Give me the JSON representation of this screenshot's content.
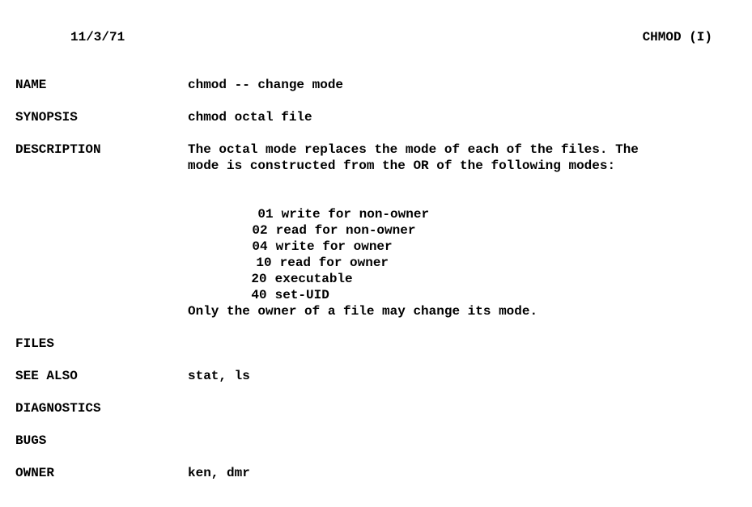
{
  "header": {
    "date": "11/3/71",
    "title": "CHMOD (I)"
  },
  "sections": {
    "name": {
      "label": "NAME",
      "text": "chmod -- change mode"
    },
    "synopsis": {
      "label": "SYNOPSIS",
      "text": "chmod octal file"
    },
    "description": {
      "label": "DESCRIPTION",
      "line1": "The octal mode replaces the mode of each of the files. The",
      "line2": "mode is constructed from the OR of the following modes:",
      "modes": [
        {
          "code": "01",
          "desc": "write for non-owner"
        },
        {
          "code": "02",
          "desc": "read for non-owner"
        },
        {
          "code": "04",
          "desc": "write for owner"
        },
        {
          "code": "10",
          "desc": "read for owner"
        },
        {
          "code": "20",
          "desc": "executable"
        },
        {
          "code": "40",
          "desc": "set-UID"
        }
      ],
      "closing": "Only the owner of a file may change its mode."
    },
    "files": {
      "label": "FILES",
      "text": ""
    },
    "see_also": {
      "label": "SEE ALSO",
      "text": "stat, ls"
    },
    "diagnostics": {
      "label": "DIAGNOSTICS",
      "text": ""
    },
    "bugs": {
      "label": "BUGS",
      "text": ""
    },
    "owner": {
      "label": "OWNER",
      "text": "ken, dmr"
    }
  }
}
